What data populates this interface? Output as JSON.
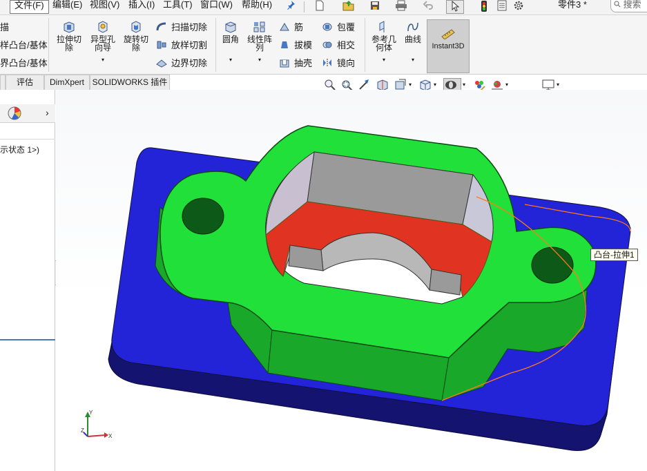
{
  "menubar": {
    "items": [
      "文件(F)",
      "编辑(E)",
      "视图(V)",
      "插入(I)",
      "工具(T)",
      "窗口(W)",
      "帮助(H)"
    ],
    "doc_title": "零件3 *",
    "search_placeholder": "搜索"
  },
  "ribbon": {
    "left_partial": [
      "描",
      "样凸台/基体",
      "界凸台/基体"
    ],
    "big": [
      {
        "label": "拉伸切\n除",
        "icon": "extruded-cut-icon"
      },
      {
        "label": "异型孔\n向导",
        "icon": "hole-wizard-icon"
      },
      {
        "label": "旋转切\n除",
        "icon": "revolved-cut-icon"
      }
    ],
    "cut_group": [
      "扫描切除",
      "放样切割",
      "边界切除"
    ],
    "fillet": "圆角",
    "pattern": "线性阵\n列",
    "features": [
      [
        "筋",
        "包覆"
      ],
      [
        "拔模",
        "相交"
      ],
      [
        "抽壳",
        "镜向"
      ]
    ],
    "ref_geometry": "参考几\n何体",
    "curves": "曲线",
    "instant3d": "Instant3D"
  },
  "tabs": [
    "评估",
    "DimXpert",
    "SOLIDWORKS 插件"
  ],
  "left_panel": {
    "tree_item": "示状态 1>)"
  },
  "viewport": {
    "tooltip": "凸台-拉伸1",
    "triad": {
      "x": "X",
      "y": "Y",
      "z": "Z"
    }
  },
  "colors": {
    "base_top": "#2323d8",
    "base_side": "#141470",
    "boss_top": "#22e03a",
    "boss_side": "#1aa82a",
    "red_face": "#e03322",
    "inner_gray": "#9a9a9a",
    "highlight": "#ff7a1a"
  }
}
